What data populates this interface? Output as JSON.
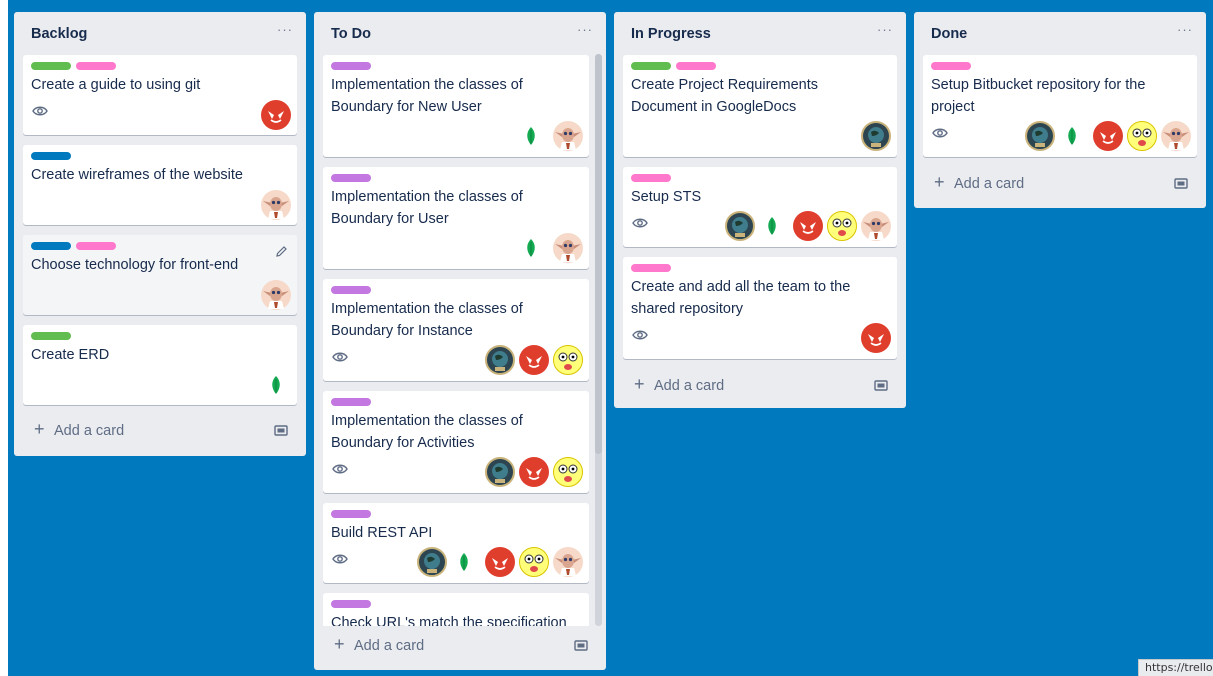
{
  "colors": {
    "board_bg": "#0079bf",
    "green": "#61bd4f",
    "pink": "#ff78cb",
    "blue": "#0079bf",
    "purple": "#c377e0"
  },
  "lists": [
    {
      "title": "Backlog",
      "menu": "···",
      "add_card": "Add a card",
      "cards": [
        {
          "title": "Create a guide to using git",
          "labels": [
            "green",
            "pink"
          ],
          "watch": true,
          "members": [
            "devil"
          ]
        },
        {
          "title": "Create wireframes of the website",
          "labels": [
            "blue"
          ],
          "watch": false,
          "members": [
            "dobby"
          ]
        },
        {
          "title": "Choose technology for front-end",
          "labels": [
            "blue",
            "pink"
          ],
          "watch": false,
          "members": [
            "dobby"
          ],
          "edit_icon": "pencil-icon"
        },
        {
          "title": "Create ERD",
          "labels": [
            "green"
          ],
          "watch": false,
          "members": [
            "leaf"
          ]
        }
      ]
    },
    {
      "title": "To Do",
      "menu": "···",
      "add_card": "Add a card",
      "cards": [
        {
          "title": "Implementation the classes of Boundary for New User",
          "labels": [
            "purple"
          ],
          "watch": false,
          "members": [
            "leaf",
            "dobby"
          ]
        },
        {
          "title": "Implementation the classes of Boundary for User",
          "labels": [
            "purple"
          ],
          "watch": false,
          "members": [
            "leaf",
            "dobby"
          ]
        },
        {
          "title": "Implementation the classes of Boundary for Instance",
          "labels": [
            "purple"
          ],
          "watch": true,
          "members": [
            "globe",
            "devil",
            "face"
          ]
        },
        {
          "title": "Implementation the classes of Boundary for Activities",
          "labels": [
            "purple"
          ],
          "watch": true,
          "members": [
            "globe",
            "devil",
            "face"
          ]
        },
        {
          "title": "Build REST API",
          "labels": [
            "purple"
          ],
          "watch": true,
          "members": [
            "globe",
            "leaf",
            "devil",
            "face",
            "dobby"
          ]
        },
        {
          "title": "Check URL's match the specification",
          "labels": [
            "purple"
          ],
          "watch": false,
          "members": []
        }
      ]
    },
    {
      "title": "In Progress",
      "menu": "···",
      "add_card": "Add a card",
      "cards": [
        {
          "title": "Create Project Requirements Document in GoogleDocs",
          "labels": [
            "green",
            "pink"
          ],
          "watch": false,
          "members": [
            "globe"
          ]
        },
        {
          "title": "Setup STS",
          "labels": [
            "pink"
          ],
          "watch": true,
          "members": [
            "globe",
            "leaf",
            "devil",
            "face",
            "dobby"
          ]
        },
        {
          "title": "Create and add all the team to the shared repository",
          "labels": [
            "pink"
          ],
          "watch": true,
          "members": [
            "devil"
          ]
        }
      ]
    },
    {
      "title": "Done",
      "menu": "···",
      "add_card": "Add a card",
      "cards": [
        {
          "title": "Setup Bitbucket repository for the project",
          "labels": [
            "pink"
          ],
          "watch": true,
          "members": [
            "globe",
            "leaf",
            "devil",
            "face",
            "dobby"
          ]
        }
      ]
    }
  ],
  "status_url": "https://trello"
}
